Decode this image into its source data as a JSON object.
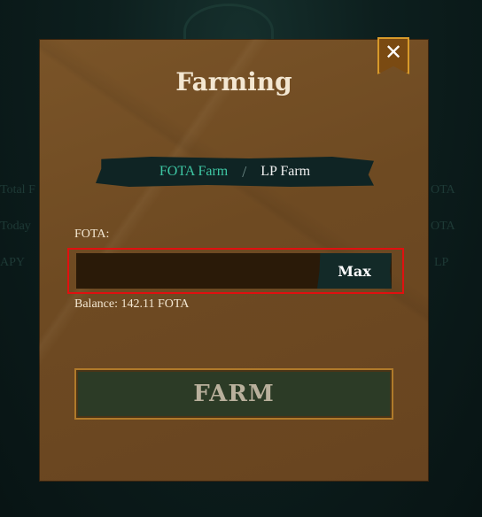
{
  "background": {
    "left_labels": [
      "Total F",
      "Today",
      "APY"
    ],
    "right_labels": [
      "OTA",
      "OTA",
      "LP"
    ]
  },
  "modal": {
    "title": "Farming",
    "close_label": "✕",
    "tabs": [
      {
        "label": "FOTA Farm",
        "active": true
      },
      {
        "label": "LP Farm",
        "active": false
      }
    ],
    "tab_separator": "/",
    "field_label": "FOTA:",
    "input_value": "",
    "input_placeholder": "",
    "max_label": "Max",
    "balance": "Balance: 142.11 FOTA",
    "farm_button": "FARM"
  },
  "colors": {
    "accent_active_tab": "#3ec7a4",
    "panel": "#6e4a22",
    "highlight_border": "#e01010"
  }
}
